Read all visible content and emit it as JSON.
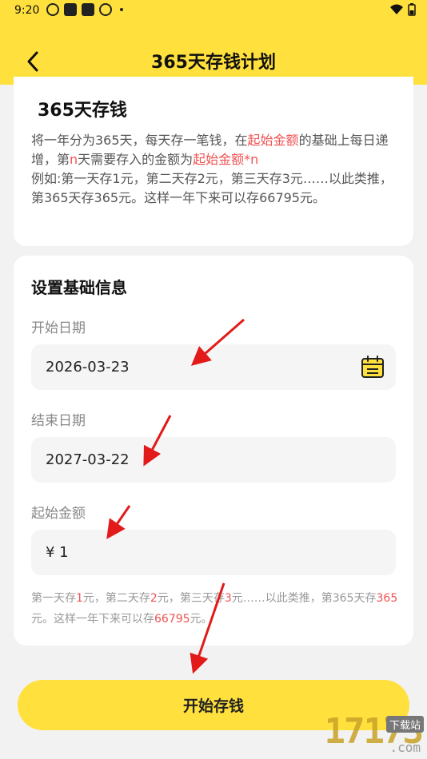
{
  "status_bar": {
    "time": "9:20"
  },
  "header": {
    "title": "365天存钱计划"
  },
  "intro": {
    "title": "365天存钱",
    "desc_part1": "将一年分为365天，每天存一笔钱，在",
    "desc_red1": "起始金额",
    "desc_part2": "的基础上每日递增，第",
    "desc_red2": "n",
    "desc_part3": "天需要存入的金额为",
    "desc_red3": "起始金额*n",
    "desc_example": "例如:第一天存1元，第二天存2元，第三天存3元……以此类推，第365天存365元。这样一年下来可以存66795元。"
  },
  "settings": {
    "title": "设置基础信息",
    "start_date_label": "开始日期",
    "start_date_value": "2026-03-23",
    "end_date_label": "结束日期",
    "end_date_value": "2027-03-22",
    "amount_label": "起始金额",
    "amount_value": "¥ 1",
    "hint_p1": "第一天存",
    "hint_r1": "1",
    "hint_p2": "元，第二天存",
    "hint_r2": "2",
    "hint_p3": "元，第三天存",
    "hint_r3": "3",
    "hint_p4": "元……以此类推，第365天存",
    "hint_r4": "365",
    "hint_p5": "元。这样一年下来可以存",
    "hint_r5": "66795",
    "hint_p6": "元。"
  },
  "footer": {
    "start_button": "开始存钱"
  },
  "watermark": {
    "number": "17173",
    "tag": "下载站",
    "domain": ".com"
  },
  "colors": {
    "accent": "#ffe03d",
    "highlight": "#f05252",
    "arrow": "#e21a1a"
  }
}
